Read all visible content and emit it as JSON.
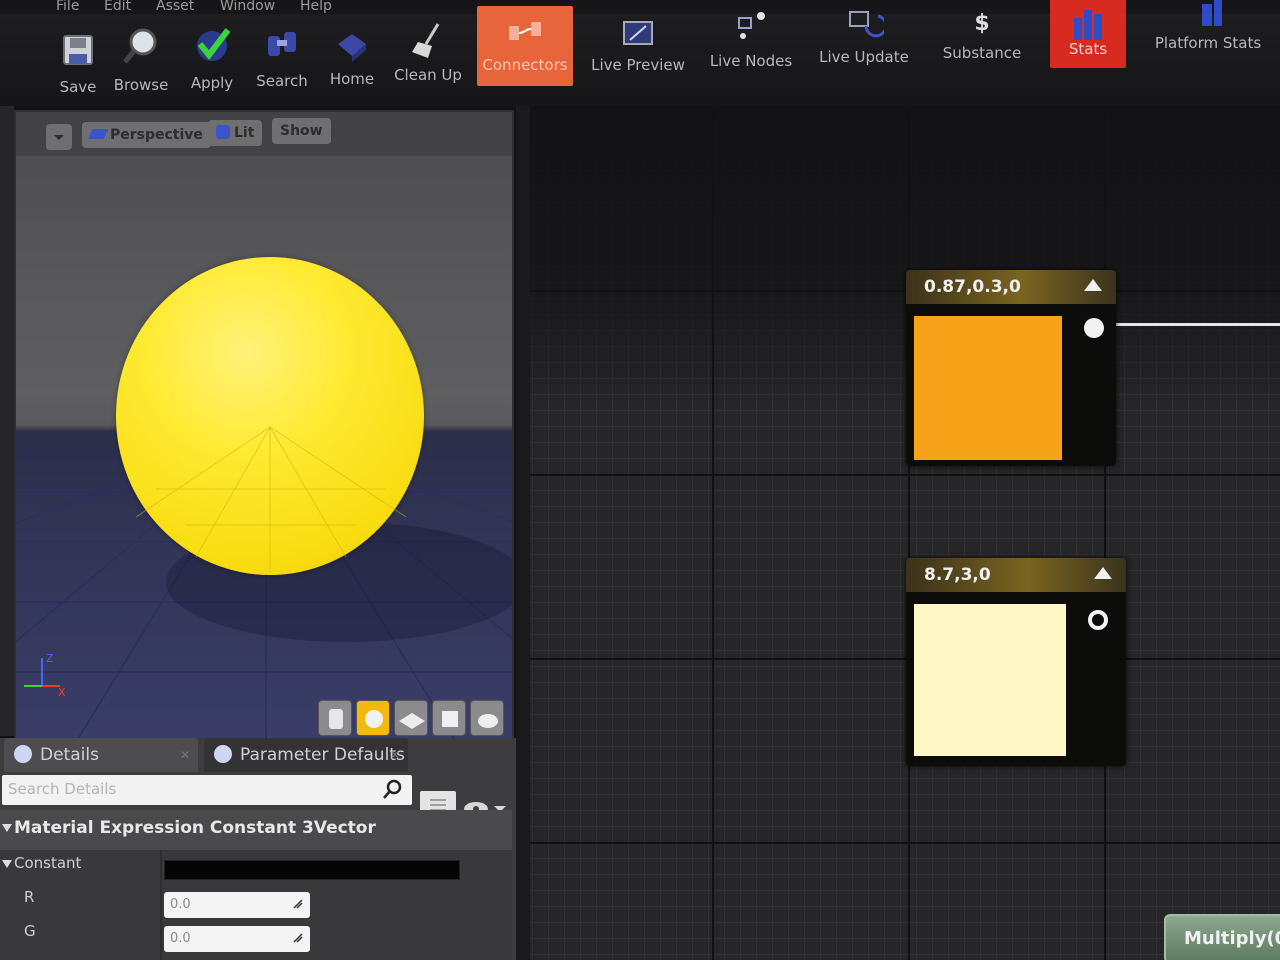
{
  "menu": [
    "File",
    "Edit",
    "Asset",
    "Window",
    "Help"
  ],
  "toolbar": {
    "save": "Save",
    "browse": "Browse",
    "apply": "Apply",
    "search": "Search",
    "home": "Home",
    "clean_up": "Clean Up",
    "connectors": "Connectors",
    "live_preview": "Live Preview",
    "live_nodes": "Live Nodes",
    "live_update": "Live Update",
    "substance": "Substance",
    "stats": "Stats",
    "platform_stats": "Platform Stats"
  },
  "viewport": {
    "perspective": "Perspective",
    "lit": "Lit",
    "show": "Show",
    "preview_color": "#f8e21c"
  },
  "details": {
    "tab_details": "Details",
    "tab_params": "Parameter Defaults",
    "search_placeholder": "Search Details",
    "category": "Material Expression Constant 3Vector",
    "constant_label": "Constant",
    "r_label": "R",
    "g_label": "G",
    "r_value": "0.0",
    "g_value": "0.0"
  },
  "graph": {
    "node1": {
      "title": "0.87,0.3,0",
      "color": "#f7a31a"
    },
    "node2": {
      "title": "8.7,3,0",
      "color": "#fff8c6"
    },
    "multiply": "Multiply(0"
  }
}
